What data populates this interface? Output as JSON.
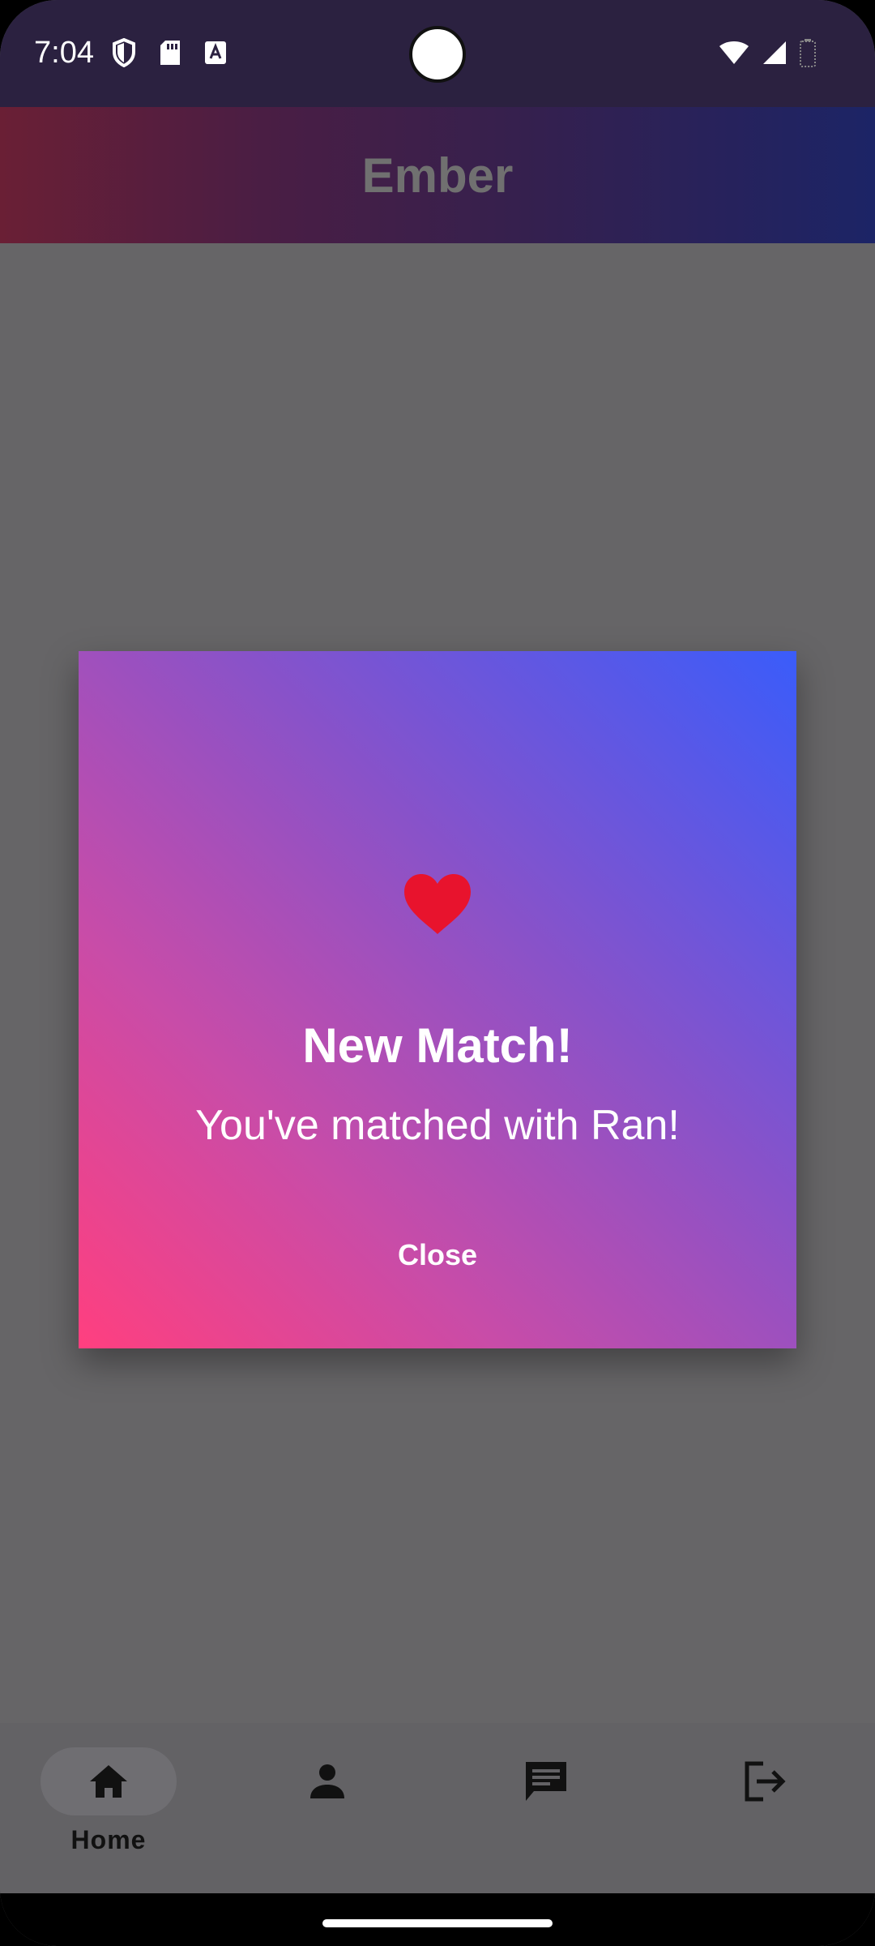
{
  "status_bar": {
    "time": "7:04",
    "left_icons": [
      "shield-icon",
      "sd-card-icon",
      "keyboard-a-icon"
    ],
    "right_icons": [
      "wifi-icon",
      "cell-signal-icon",
      "battery-icon"
    ]
  },
  "app_bar": {
    "title": "Ember"
  },
  "dialog": {
    "icon": "heart-icon",
    "title": "New Match!",
    "message": "You've matched with Ran!",
    "close_label": "Close"
  },
  "bottom_nav": {
    "items": [
      {
        "icon": "home-icon",
        "label": "Home",
        "active": true
      },
      {
        "icon": "person-icon",
        "label": "",
        "active": false
      },
      {
        "icon": "chat-icon",
        "label": "",
        "active": false
      },
      {
        "icon": "logout-icon",
        "label": "",
        "active": false
      }
    ]
  },
  "colors": {
    "status_bar": "#2b2140",
    "dim_overlay": "#666567",
    "dialog_gradient_start": "#ff3f7f",
    "dialog_gradient_end": "#3a5cfa",
    "heart": "#e8132d"
  }
}
